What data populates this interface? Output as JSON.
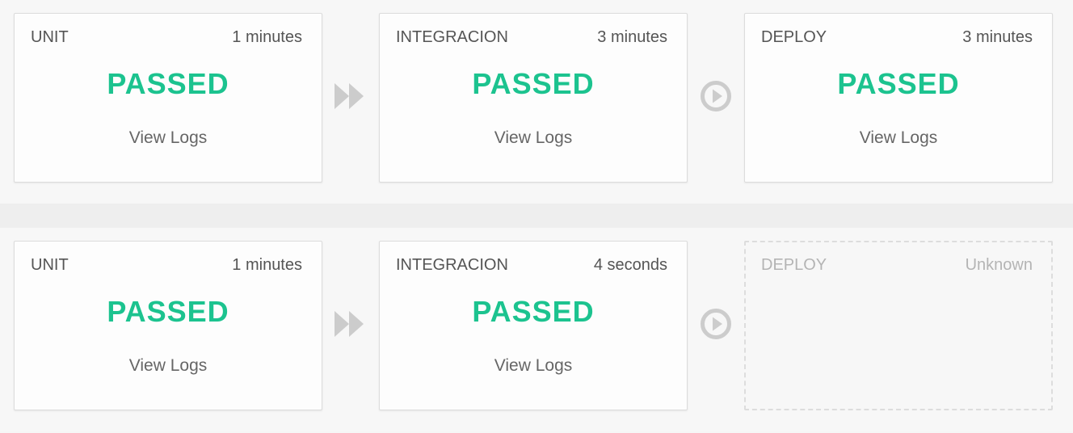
{
  "colors": {
    "passed": "#1cc38f",
    "text": "#555555",
    "muted": "#b4b4b4",
    "connector": "#cccccc"
  },
  "icons": {
    "after_unit": "fast-forward-icon",
    "after_integration": "play-circle-icon"
  },
  "pipelines": [
    {
      "stages": [
        {
          "name": "UNIT",
          "duration": "1 minutes",
          "status": "PASSED",
          "logs_label": "View Logs"
        },
        {
          "name": "INTEGRACION",
          "duration": "3 minutes",
          "status": "PASSED",
          "logs_label": "View Logs"
        },
        {
          "name": "DEPLOY",
          "duration": "3 minutes",
          "status": "PASSED",
          "logs_label": "View Logs"
        }
      ]
    },
    {
      "stages": [
        {
          "name": "UNIT",
          "duration": "1 minutes",
          "status": "PASSED",
          "logs_label": "View Logs"
        },
        {
          "name": "INTEGRACION",
          "duration": "4 seconds",
          "status": "PASSED",
          "logs_label": "View Logs"
        },
        {
          "name": "DEPLOY",
          "duration": "Unknown"
        }
      ]
    }
  ]
}
